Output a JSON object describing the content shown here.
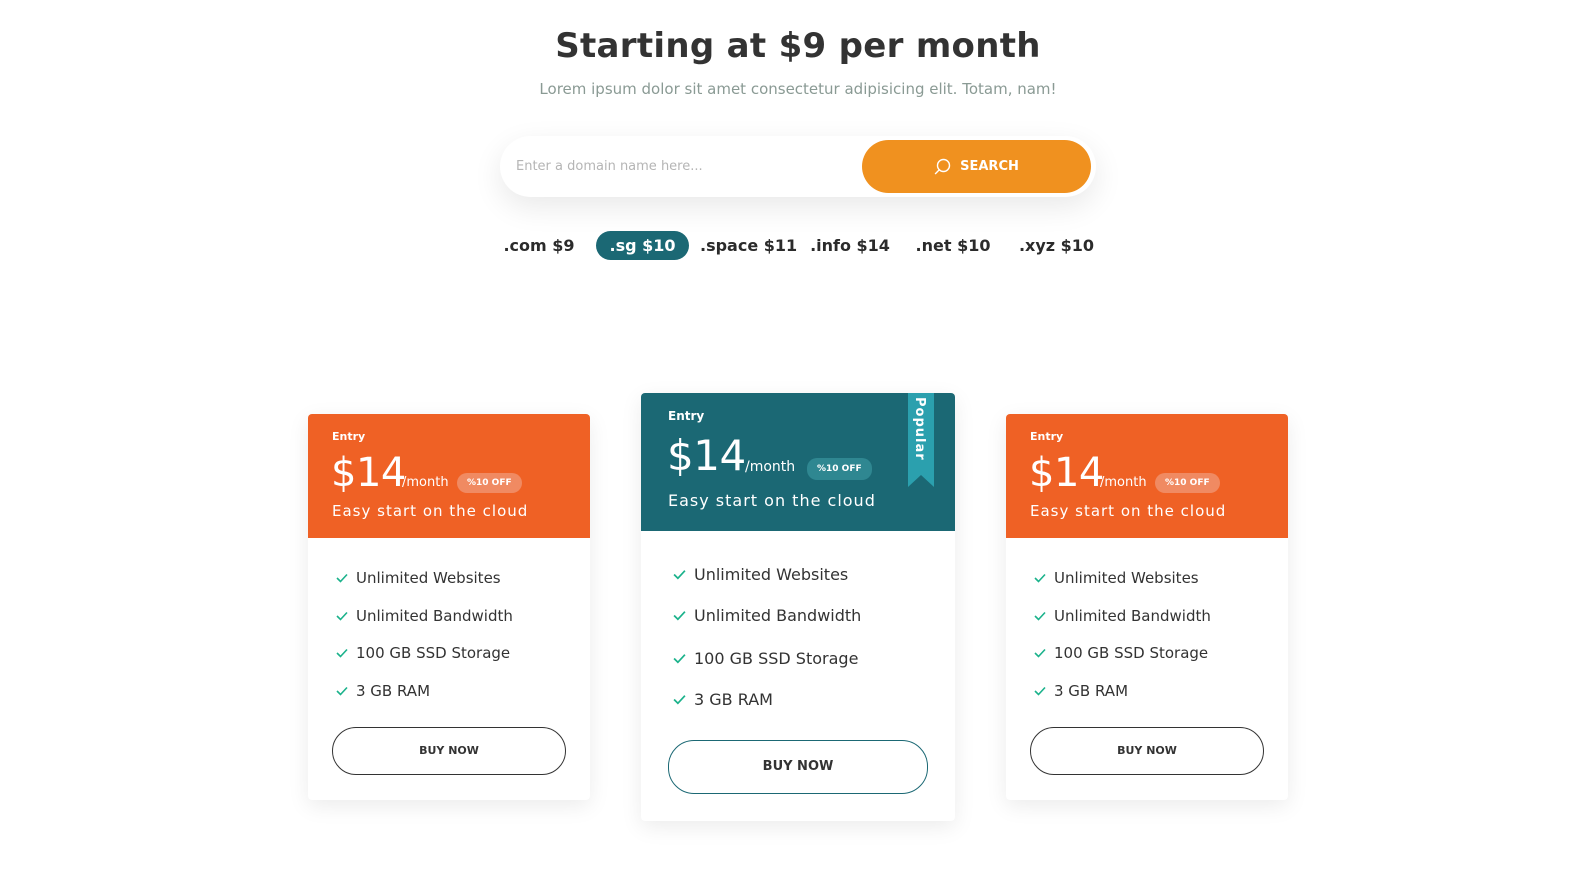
{
  "hero": {
    "title": "Starting at $9 per month",
    "subtitle": "Lorem ipsum dolor sit amet consectetur adipisicing elit. Totam, nam!"
  },
  "search": {
    "placeholder": "Enter a domain name here...",
    "value": "",
    "button_label": "SEARCH"
  },
  "tlds": [
    {
      "label": ".com $9",
      "active": false
    },
    {
      "label": ".sg $10",
      "active": true
    },
    {
      "label": ".space $11",
      "active": false
    },
    {
      "label": ".info $14",
      "active": false
    },
    {
      "label": ".net $10",
      "active": false
    },
    {
      "label": ".xyz $10",
      "active": false
    }
  ],
  "plans": [
    {
      "name": "Entry",
      "price": "$14",
      "period": "/month",
      "discount": "%10 OFF",
      "tagline": "Easy start on the cloud",
      "features": [
        "Unlimited Websites",
        "Unlimited Bandwidth",
        "100 GB SSD Storage",
        "3 GB RAM"
      ],
      "button_label": "BUY NOW"
    },
    {
      "name": "Entry",
      "price": "$14",
      "period": "/month",
      "discount": "%10 OFF",
      "tagline": "Easy start on the cloud",
      "features": [
        "Unlimited Websites",
        "Unlimited Bandwidth",
        "100 GB SSD Storage",
        "3 GB RAM"
      ],
      "button_label": "BUY NOW",
      "ribbon": "Popular"
    },
    {
      "name": "Entry",
      "price": "$14",
      "period": "/month",
      "discount": "%10 OFF",
      "tagline": "Easy start on the cloud",
      "features": [
        "Unlimited Websites",
        "Unlimited Bandwidth",
        "100 GB SSD Storage",
        "3 GB RAM"
      ],
      "button_label": "BUY NOW"
    }
  ],
  "colors": {
    "accent_orange": "#f0911f",
    "card_orange": "#ef6125",
    "teal": "#1b6874",
    "ribbon": "#2ba0ae",
    "check": "#1bb28b"
  },
  "icons": {
    "search": "search-icon",
    "check": "check-icon"
  }
}
